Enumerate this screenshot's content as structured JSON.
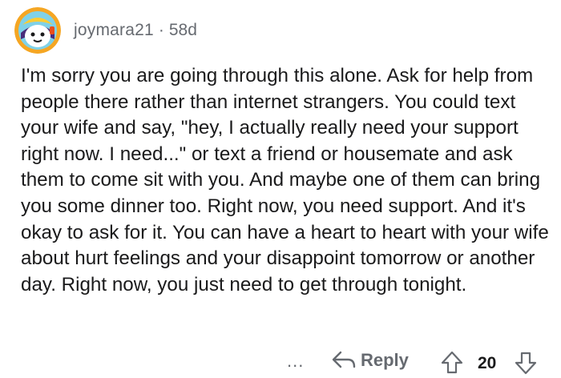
{
  "comment": {
    "author": "joymara21",
    "separator": "·",
    "age": "58d",
    "body": "I'm sorry you are going through this alone. Ask for help from people there rather than internet strangers. You could text your wife and say, \"hey, I actually really need your support right now. I need...\" or text a friend or housemate and ask them to come sit with you. And maybe one of them can bring you some dinner too. Right now, you need support. And it's okay to ask for it. You can have a heart to heart with your wife about hurt feelings and your disappoint tomorrow or another day. Right now, you just need to get through tonight.",
    "actions": {
      "more_label": "...",
      "reply_label": "Reply",
      "vote_count": "20"
    },
    "icons": {
      "avatar": "avatar-icon",
      "reply": "reply-arrow-icon",
      "upvote": "upvote-arrow-icon",
      "downvote": "downvote-arrow-icon"
    },
    "colors": {
      "meta_text": "#666a70",
      "body_text": "#1a1a1b",
      "avatar_bg": "#f5a623"
    }
  }
}
